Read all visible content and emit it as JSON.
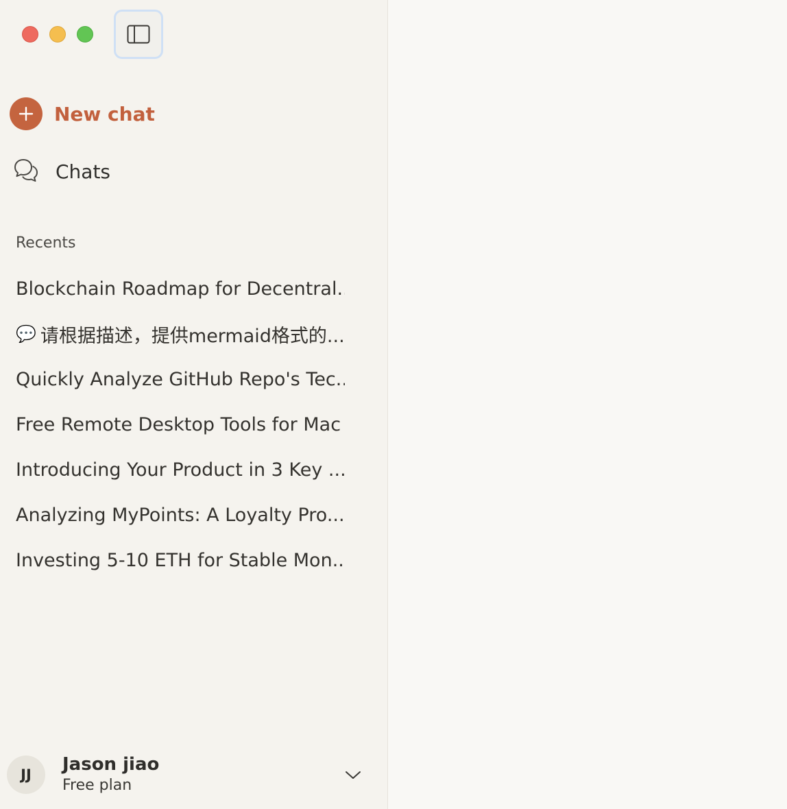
{
  "window": {
    "controls": [
      "close",
      "minimize",
      "maximize"
    ]
  },
  "sidebar": {
    "toggle_icon": "sidebar-toggle-icon",
    "new_chat_label": "New chat",
    "chats_label": "Chats",
    "recents_header": "Recents",
    "recents": [
      {
        "label": "Blockchain Roadmap for Decentral...",
        "emoji": ""
      },
      {
        "label": "请根据描述，提供mermaid格式的...",
        "emoji": "💬"
      },
      {
        "label": "Quickly Analyze GitHub Repo's Tec...",
        "emoji": ""
      },
      {
        "label": "Free Remote Desktop Tools for Mac",
        "emoji": ""
      },
      {
        "label": "Introducing Your Product in 3 Key ...",
        "emoji": ""
      },
      {
        "label": "Analyzing MyPoints: A Loyalty Pro...",
        "emoji": ""
      },
      {
        "label": "Investing 5-10 ETH for Stable Mon...",
        "emoji": ""
      }
    ]
  },
  "user": {
    "initials": "JJ",
    "name": "Jason jiao",
    "plan": "Free plan"
  },
  "colors": {
    "accent": "#c4643f",
    "sidebar_bg": "#f5f3ee",
    "main_bg": "#f9f8f5"
  }
}
